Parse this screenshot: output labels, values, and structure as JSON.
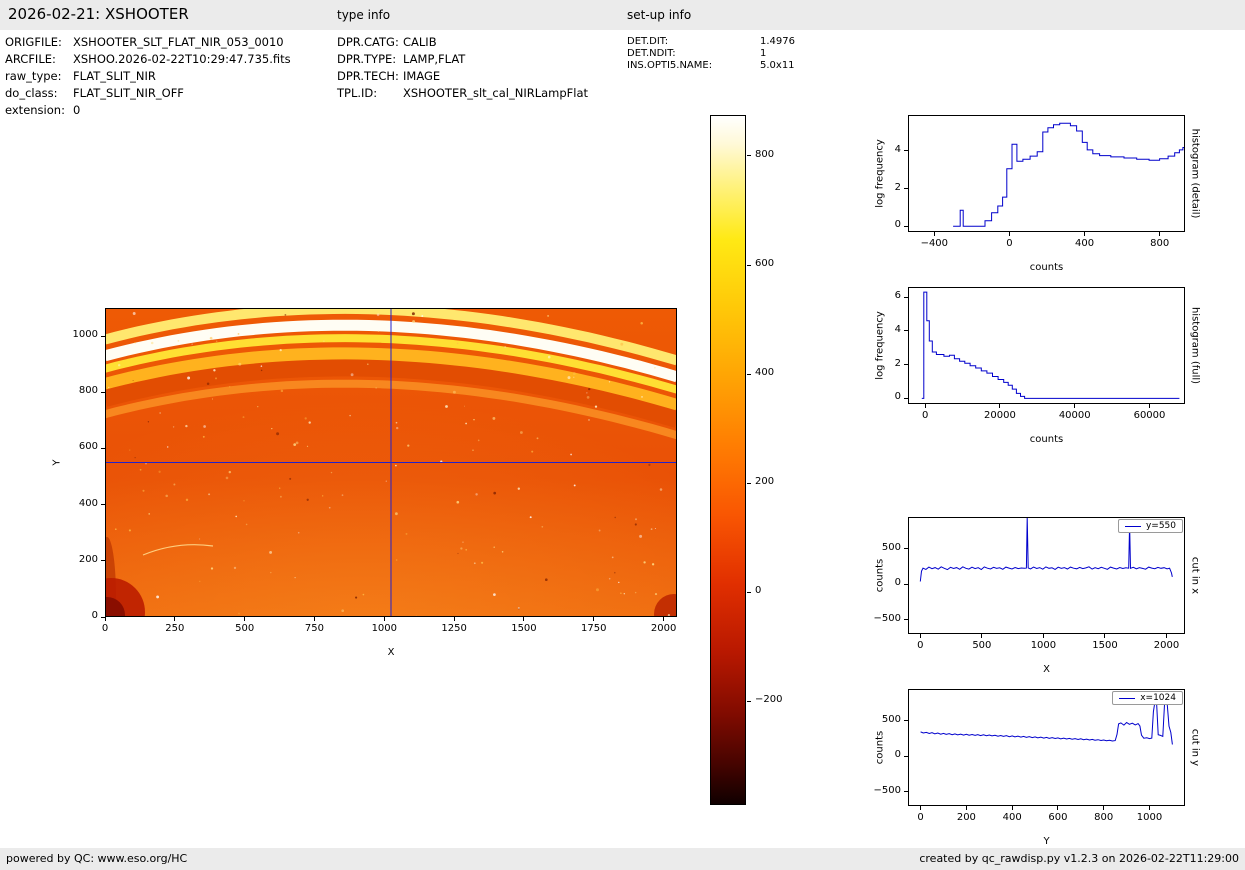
{
  "header": {
    "title": "2026-02-21: XSHOOTER",
    "type_info_label": "type info",
    "setup_info_label": "set-up info"
  },
  "file_info": [
    {
      "label": "ORIGFILE:",
      "value": "XSHOOTER_SLT_FLAT_NIR_053_0010"
    },
    {
      "label": "ARCFILE:",
      "value": "XSHOO.2026-02-22T10:29:47.735.fits"
    },
    {
      "label": "raw_type:",
      "value": "FLAT_SLIT_NIR"
    },
    {
      "label": "do_class:",
      "value": "FLAT_SLIT_NIR_OFF"
    },
    {
      "label": "extension:",
      "value": "0"
    }
  ],
  "type_info": [
    {
      "label": "DPR.CATG:",
      "value": "CALIB"
    },
    {
      "label": "DPR.TYPE:",
      "value": "LAMP,FLAT"
    },
    {
      "label": "DPR.TECH:",
      "value": "IMAGE"
    },
    {
      "label": "TPL.ID:",
      "value": "XSHOOTER_slt_cal_NIRLampFlat"
    }
  ],
  "setup_info": [
    {
      "label": "DET.DIT:",
      "value": "1.4976"
    },
    {
      "label": "DET.NDIT:",
      "value": "1"
    },
    {
      "label": "INS.OPTI5.NAME:",
      "value": "5.0x11"
    }
  ],
  "footer": {
    "left": "powered by QC: www.eso.org/HC",
    "right": "created by qc_rawdisp.py v1.2.3 on 2026-02-22T11:29:00"
  },
  "colors": {
    "plot_line": "#0000cc",
    "crosshair": "#2222cc",
    "bar_bg": "#ebebeb"
  },
  "chart_data": [
    {
      "type": "heatmap",
      "name": "detector-image",
      "xlabel": "X",
      "ylabel": "Y",
      "xlim": [
        0,
        2048
      ],
      "ylim": [
        0,
        1100
      ],
      "xticks": [
        0,
        250,
        500,
        750,
        1000,
        1250,
        1500,
        1750,
        2000
      ],
      "yticks": [
        0,
        200,
        400,
        600,
        800,
        1000
      ],
      "crosshair": {
        "x": 1024,
        "y": 550
      },
      "arc": {
        "x0": 0,
        "y0": 930,
        "cx": 950,
        "cy": 1180,
        "x1": 2048,
        "y1": 855
      },
      "bands": [
        {
          "offset": 58,
          "width": 10,
          "color": "#ffe76e"
        },
        {
          "offset": 0,
          "width": 11,
          "color": "#fffdf4"
        },
        {
          "offset": -46,
          "width": 8,
          "color": "#ffdf33"
        },
        {
          "offset": -102,
          "width": 13,
          "color": "#ffb21e"
        },
        {
          "offset": -152,
          "width": 17,
          "color": "#e24d02"
        },
        {
          "offset": -208,
          "width": 8,
          "color": "#f8871f"
        }
      ],
      "background": {
        "top": "#ee5a05",
        "mid": "#e95106",
        "bottom": "#ef6b10"
      },
      "speckle_count": 170,
      "colorbar": {
        "colormap": "hot",
        "vmin": -390,
        "vmax": 875,
        "ticks": [
          800,
          600,
          400,
          200,
          0,
          -200
        ]
      },
      "description": "NIR lamp-flat raw frame shown in hot colormap with bright curved spectral-order arcs near the top and blue crosshair cuts at x=1024, y=550"
    },
    {
      "type": "line",
      "name": "histogram-detail",
      "xlabel": "counts",
      "ylabel": "log frequency",
      "side_label": "histogram (detail)",
      "xlim": [
        -540,
        935
      ],
      "ylim": [
        -0.3,
        5.9
      ],
      "xticks": [
        -400,
        0,
        400,
        800
      ],
      "yticks": [
        0,
        2,
        4
      ],
      "step": true,
      "points": [
        [
          -300,
          0
        ],
        [
          -262,
          0
        ],
        [
          -262,
          0.85
        ],
        [
          -246,
          0.85
        ],
        [
          -246,
          0
        ],
        [
          -130,
          0
        ],
        [
          -130,
          0.3
        ],
        [
          -95,
          0.3
        ],
        [
          -95,
          0.72
        ],
        [
          -62,
          0.72
        ],
        [
          -62,
          1.08
        ],
        [
          -36,
          1.08
        ],
        [
          -36,
          1.55
        ],
        [
          -14,
          1.55
        ],
        [
          -14,
          3.05
        ],
        [
          14,
          3.05
        ],
        [
          14,
          4.35
        ],
        [
          40,
          4.35
        ],
        [
          40,
          3.45
        ],
        [
          72,
          3.45
        ],
        [
          72,
          3.55
        ],
        [
          110,
          3.55
        ],
        [
          110,
          3.72
        ],
        [
          148,
          3.72
        ],
        [
          148,
          3.95
        ],
        [
          178,
          3.95
        ],
        [
          178,
          5.0
        ],
        [
          205,
          5.0
        ],
        [
          205,
          5.22
        ],
        [
          235,
          5.22
        ],
        [
          235,
          5.38
        ],
        [
          268,
          5.38
        ],
        [
          268,
          5.46
        ],
        [
          325,
          5.46
        ],
        [
          325,
          5.33
        ],
        [
          358,
          5.33
        ],
        [
          358,
          5.05
        ],
        [
          388,
          5.05
        ],
        [
          388,
          4.45
        ],
        [
          414,
          4.45
        ],
        [
          414,
          4.05
        ],
        [
          444,
          4.05
        ],
        [
          444,
          3.85
        ],
        [
          480,
          3.85
        ],
        [
          480,
          3.75
        ],
        [
          540,
          3.75
        ],
        [
          540,
          3.68
        ],
        [
          610,
          3.68
        ],
        [
          610,
          3.62
        ],
        [
          678,
          3.62
        ],
        [
          678,
          3.56
        ],
        [
          744,
          3.56
        ],
        [
          744,
          3.5
        ],
        [
          800,
          3.5
        ],
        [
          800,
          3.58
        ],
        [
          845,
          3.58
        ],
        [
          845,
          3.72
        ],
        [
          880,
          3.72
        ],
        [
          880,
          3.9
        ],
        [
          905,
          3.9
        ],
        [
          905,
          4.05
        ],
        [
          924,
          4.05
        ],
        [
          924,
          4.18
        ],
        [
          930,
          4.18
        ]
      ]
    },
    {
      "type": "line",
      "name": "histogram-full",
      "xlabel": "counts",
      "ylabel": "log frequency",
      "side_label": "histogram (full)",
      "xlim": [
        -4600,
        69500
      ],
      "ylim": [
        -0.33,
        6.6
      ],
      "xticks": [
        0,
        20000,
        40000,
        60000
      ],
      "yticks": [
        0,
        2,
        4,
        6
      ],
      "step": true,
      "points": [
        [
          -900,
          0
        ],
        [
          -380,
          0
        ],
        [
          -380,
          6.3
        ],
        [
          430,
          6.3
        ],
        [
          430,
          4.6
        ],
        [
          1100,
          4.6
        ],
        [
          1100,
          3.4
        ],
        [
          1900,
          3.4
        ],
        [
          1900,
          2.75
        ],
        [
          3000,
          2.75
        ],
        [
          3000,
          2.6
        ],
        [
          5000,
          2.6
        ],
        [
          5000,
          2.5
        ],
        [
          6500,
          2.5
        ],
        [
          6500,
          2.56
        ],
        [
          7800,
          2.56
        ],
        [
          7800,
          2.35
        ],
        [
          9200,
          2.35
        ],
        [
          9200,
          2.2
        ],
        [
          10600,
          2.2
        ],
        [
          10600,
          2.08
        ],
        [
          12000,
          2.08
        ],
        [
          12000,
          1.94
        ],
        [
          13500,
          1.94
        ],
        [
          13500,
          1.8
        ],
        [
          15000,
          1.8
        ],
        [
          15000,
          1.63
        ],
        [
          16500,
          1.63
        ],
        [
          16500,
          1.5
        ],
        [
          18000,
          1.5
        ],
        [
          18000,
          1.3
        ],
        [
          19500,
          1.3
        ],
        [
          19500,
          1.12
        ],
        [
          21000,
          1.12
        ],
        [
          21000,
          0.95
        ],
        [
          22200,
          0.95
        ],
        [
          22200,
          0.78
        ],
        [
          23300,
          0.78
        ],
        [
          23300,
          0.55
        ],
        [
          24400,
          0.55
        ],
        [
          24400,
          0.3
        ],
        [
          25500,
          0.3
        ],
        [
          25500,
          0.12
        ],
        [
          26600,
          0.12
        ],
        [
          26600,
          0
        ],
        [
          68000,
          0
        ]
      ]
    },
    {
      "type": "line",
      "name": "cut-in-x",
      "xlabel": "X",
      "ylabel": "counts",
      "side_label": "cut in x",
      "legend": "y=550",
      "xlim": [
        -100,
        2150
      ],
      "ylim": [
        -700,
        950
      ],
      "xticks": [
        0,
        500,
        1000,
        1500,
        2000
      ],
      "yticks": [
        -500,
        0,
        500
      ],
      "points": [
        [
          0,
          40
        ],
        [
          10,
          185
        ],
        [
          22,
          228
        ],
        [
          45,
          211
        ],
        [
          70,
          243
        ],
        [
          95,
          221
        ],
        [
          120,
          236
        ],
        [
          145,
          214
        ],
        [
          170,
          247
        ],
        [
          195,
          226
        ],
        [
          220,
          208
        ],
        [
          245,
          241
        ],
        [
          270,
          224
        ],
        [
          295,
          237
        ],
        [
          320,
          212
        ],
        [
          345,
          248
        ],
        [
          370,
          227
        ],
        [
          395,
          215
        ],
        [
          420,
          242
        ],
        [
          445,
          223
        ],
        [
          470,
          235
        ],
        [
          495,
          210
        ],
        [
          520,
          246
        ],
        [
          545,
          228
        ],
        [
          570,
          216
        ],
        [
          595,
          240
        ],
        [
          620,
          225
        ],
        [
          645,
          234
        ],
        [
          670,
          213
        ],
        [
          695,
          244
        ],
        [
          720,
          229
        ],
        [
          745,
          217
        ],
        [
          770,
          238
        ],
        [
          795,
          222
        ],
        [
          820,
          231
        ],
        [
          845,
          226
        ],
        [
          862,
          230
        ],
        [
          868,
          948
        ],
        [
          876,
          232
        ],
        [
          895,
          218
        ],
        [
          920,
          243
        ],
        [
          945,
          224
        ],
        [
          970,
          236
        ],
        [
          995,
          214
        ],
        [
          1020,
          246
        ],
        [
          1045,
          227
        ],
        [
          1070,
          233
        ],
        [
          1095,
          211
        ],
        [
          1120,
          242
        ],
        [
          1145,
          225
        ],
        [
          1170,
          237
        ],
        [
          1195,
          216
        ],
        [
          1220,
          244
        ],
        [
          1245,
          228
        ],
        [
          1270,
          219
        ],
        [
          1295,
          239
        ],
        [
          1320,
          223
        ],
        [
          1345,
          232
        ],
        [
          1370,
          247
        ],
        [
          1395,
          215
        ],
        [
          1420,
          235
        ],
        [
          1445,
          221
        ],
        [
          1470,
          240
        ],
        [
          1495,
          226
        ],
        [
          1520,
          212
        ],
        [
          1545,
          243
        ],
        [
          1570,
          230
        ],
        [
          1595,
          217
        ],
        [
          1620,
          238
        ],
        [
          1645,
          224
        ],
        [
          1670,
          233
        ],
        [
          1693,
          228
        ],
        [
          1700,
          858
        ],
        [
          1707,
          226
        ],
        [
          1730,
          241
        ],
        [
          1755,
          220
        ],
        [
          1780,
          236
        ],
        [
          1805,
          225
        ],
        [
          1830,
          214
        ],
        [
          1855,
          244
        ],
        [
          1880,
          229
        ],
        [
          1905,
          221
        ],
        [
          1930,
          239
        ],
        [
          1955,
          227
        ],
        [
          1980,
          235
        ],
        [
          2005,
          218
        ],
        [
          2025,
          228
        ],
        [
          2040,
          160
        ],
        [
          2047,
          105
        ]
      ]
    },
    {
      "type": "line",
      "name": "cut-in-y",
      "xlabel": "Y",
      "ylabel": "counts",
      "side_label": "cut in y",
      "legend": "x=1024",
      "xlim": [
        -55,
        1155
      ],
      "ylim": [
        -700,
        950
      ],
      "xticks": [
        0,
        200,
        400,
        600,
        800,
        1000
      ],
      "yticks": [
        -500,
        0,
        500
      ],
      "points": [
        [
          0,
          345
        ],
        [
          12,
          330
        ],
        [
          25,
          338
        ],
        [
          38,
          322
        ],
        [
          50,
          334
        ],
        [
          62,
          318
        ],
        [
          75,
          329
        ],
        [
          88,
          312
        ],
        [
          100,
          324
        ],
        [
          112,
          310
        ],
        [
          125,
          320
        ],
        [
          138,
          306
        ],
        [
          150,
          317
        ],
        [
          162,
          303
        ],
        [
          175,
          314
        ],
        [
          188,
          300
        ],
        [
          200,
          311
        ],
        [
          212,
          298
        ],
        [
          225,
          309
        ],
        [
          238,
          296
        ],
        [
          250,
          307
        ],
        [
          262,
          293
        ],
        [
          275,
          304
        ],
        [
          288,
          291
        ],
        [
          300,
          301
        ],
        [
          312,
          288
        ],
        [
          325,
          297
        ],
        [
          338,
          285
        ],
        [
          350,
          294
        ],
        [
          362,
          281
        ],
        [
          375,
          291
        ],
        [
          388,
          278
        ],
        [
          400,
          288
        ],
        [
          412,
          275
        ],
        [
          425,
          284
        ],
        [
          438,
          271
        ],
        [
          450,
          281
        ],
        [
          462,
          268
        ],
        [
          475,
          277
        ],
        [
          488,
          264
        ],
        [
          500,
          274
        ],
        [
          512,
          261
        ],
        [
          525,
          271
        ],
        [
          538,
          258
        ],
        [
          550,
          267
        ],
        [
          562,
          255
        ],
        [
          575,
          264
        ],
        [
          588,
          252
        ],
        [
          600,
          261
        ],
        [
          612,
          248
        ],
        [
          625,
          257
        ],
        [
          638,
          245
        ],
        [
          650,
          254
        ],
        [
          662,
          242
        ],
        [
          675,
          250
        ],
        [
          688,
          238
        ],
        [
          700,
          247
        ],
        [
          712,
          235
        ],
        [
          725,
          243
        ],
        [
          738,
          231
        ],
        [
          750,
          239
        ],
        [
          762,
          228
        ],
        [
          775,
          235
        ],
        [
          788,
          224
        ],
        [
          800,
          231
        ],
        [
          812,
          221
        ],
        [
          825,
          227
        ],
        [
          838,
          217
        ],
        [
          850,
          222
        ],
        [
          858,
          310
        ],
        [
          865,
          458
        ],
        [
          875,
          472
        ],
        [
          888,
          441
        ],
        [
          900,
          478
        ],
        [
          912,
          452
        ],
        [
          925,
          468
        ],
        [
          938,
          444
        ],
        [
          950,
          462
        ],
        [
          958,
          428
        ],
        [
          965,
          298
        ],
        [
          975,
          256
        ],
        [
          988,
          262
        ],
        [
          1000,
          250
        ],
        [
          1010,
          257
        ],
        [
          1017,
          630
        ],
        [
          1024,
          778
        ],
        [
          1031,
          752
        ],
        [
          1038,
          305
        ],
        [
          1048,
          295
        ],
        [
          1058,
          282
        ],
        [
          1066,
          758
        ],
        [
          1076,
          792
        ],
        [
          1085,
          425
        ],
        [
          1093,
          338
        ],
        [
          1100,
          168
        ]
      ]
    }
  ]
}
